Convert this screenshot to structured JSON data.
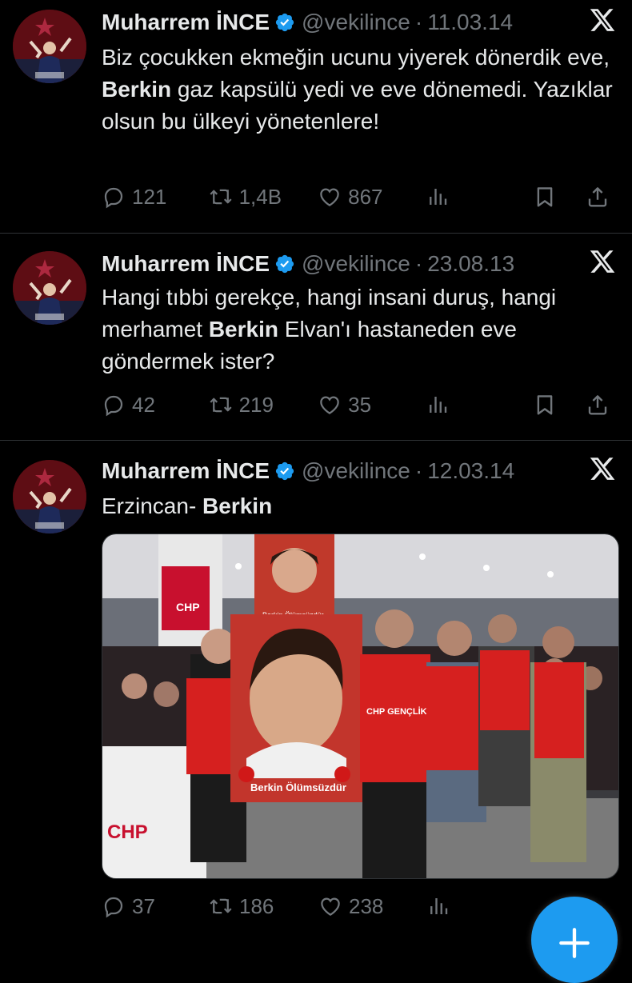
{
  "colors": {
    "background": "#000000",
    "text": "#e7e9ea",
    "muted": "#71767b",
    "verified": "#1d9bf0",
    "fab": "#1d9bf0"
  },
  "tweets": [
    {
      "name": "Muharrem İNCE",
      "handle": "@vekilince",
      "separator": "·",
      "date": "11.03.14",
      "text_parts": [
        "Biz çocukken ekmeğin ucunu yiyerek dönerdik eve, ",
        "Berkin",
        " gaz kapsülü yedi ve eve dönemedi. Yazıklar olsun bu ülkeyi yönetenlere!"
      ],
      "replies": "121",
      "retweets": "1,4B",
      "likes": "867"
    },
    {
      "name": "Muharrem İNCE",
      "handle": "@vekilince",
      "separator": "·",
      "date": "23.08.13",
      "text_parts": [
        "Hangi tıbbi gerekçe, hangi insani duruş, hangi merhamet ",
        "Berkin",
        " Elvan'ı hastaneden eve göndermek ister?"
      ],
      "replies": "42",
      "retweets": "219",
      "likes": "35"
    },
    {
      "name": "Muharrem İNCE",
      "handle": "@vekilince",
      "separator": "·",
      "date": "12.03.14",
      "text_parts": [
        "Erzincan- ",
        "Berkin",
        ""
      ],
      "replies": "37",
      "retweets": "186",
      "likes": "238",
      "media": {
        "poster_caption": "Berkin Ölümsüzdür",
        "small_poster_caption": "Berkin Ölümsüzdür",
        "vest_text": "CHP GENÇLİK KOLLARI",
        "banner_text": "CHP",
        "flag_text": "CHP"
      }
    }
  ],
  "icons": {
    "avatar": "profile-photo",
    "verified": "verified-badge-icon",
    "platform": "x-logo-icon",
    "reply": "reply-icon",
    "retweet": "retweet-icon",
    "like": "heart-icon",
    "views": "views-icon",
    "bookmark": "bookmark-icon",
    "share": "share-icon",
    "compose": "plus-icon"
  }
}
